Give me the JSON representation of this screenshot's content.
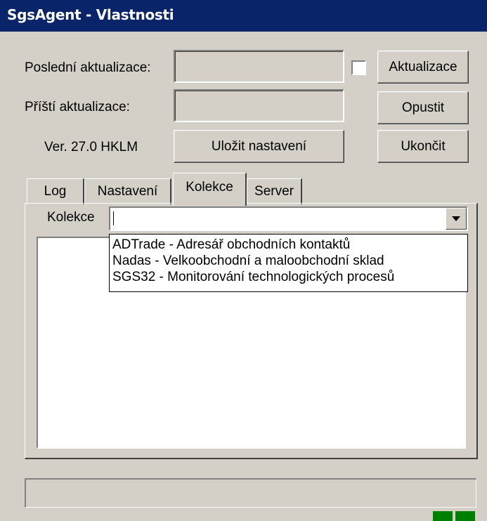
{
  "window": {
    "title": "SgsAgent - Vlastnosti"
  },
  "form": {
    "last_update_label": "Poslední aktualizace:",
    "last_update_value": "",
    "next_update_label": "Příští aktualizace:",
    "next_update_value": "",
    "version_label": "Ver. 27.0 HKLM",
    "save_settings_label": "Uložit nastavení",
    "update_button_label": "Aktualizace",
    "leave_button_label": "Opustit",
    "exit_button_label": "Ukončit",
    "auto_update_checked": false
  },
  "tabs": [
    {
      "label": "Log",
      "active": false
    },
    {
      "label": "Nastavení",
      "active": false
    },
    {
      "label": "Kolekce",
      "active": true
    },
    {
      "label": "Server",
      "active": false
    }
  ],
  "collection_tab": {
    "combo_label": "Kolekce",
    "combo_value": "",
    "options": [
      "ADTrade - Adresář obchodních kontaktů",
      "Nadas - Velkoobchodní a maloobchodní sklad",
      "SGS32 - Monitorování technologických procesů"
    ]
  },
  "status_bar": {
    "text": "",
    "indicator_color": "#008000"
  }
}
